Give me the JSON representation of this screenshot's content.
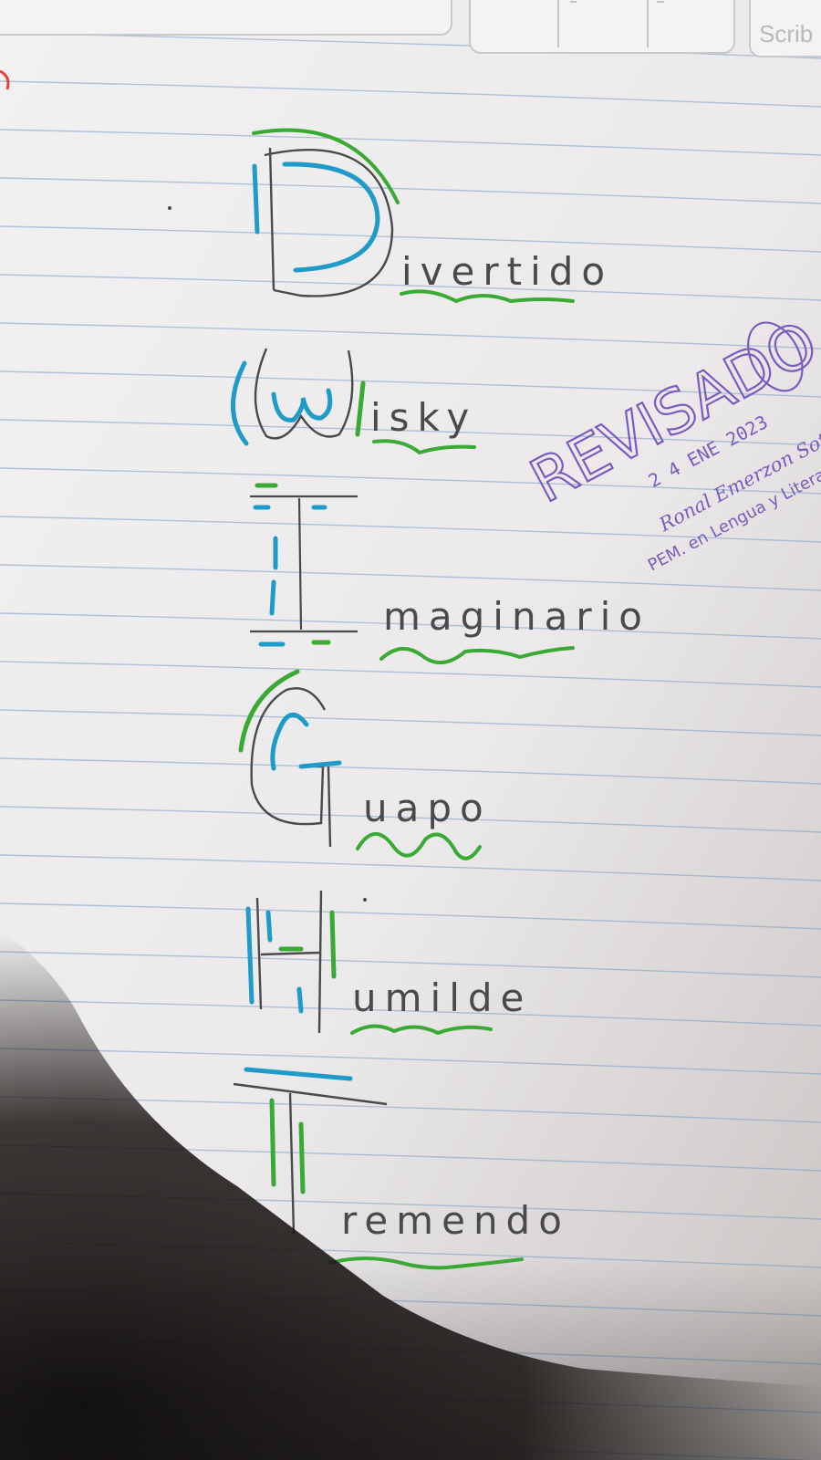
{
  "colors": {
    "paper": "#ecebec",
    "paper_dark": "#c9c5c4",
    "ruled_line": "#7c9bc4",
    "margin_line": "#e0453c",
    "pencil": "#4a4a4a",
    "blue_marker": "#1f9bc9",
    "green_marker": "#3aaa35",
    "stamp_ink": "#7a5cc0",
    "shadow": "#0f0c0b"
  },
  "top_strip": {
    "label_partial": "Scrib",
    "icon": "ruler-tick-marks-icon"
  },
  "acrostic": {
    "words": [
      {
        "letter": "D",
        "rest": "ivertido"
      },
      {
        "letter": "W",
        "rest": "isky"
      },
      {
        "letter": "I",
        "rest": "maginario"
      },
      {
        "letter": "G",
        "rest": "uapo"
      },
      {
        "letter": "H",
        "rest": "umilde"
      },
      {
        "letter": "T",
        "rest": "remendo"
      }
    ]
  },
  "stamp": {
    "title": "REVISADO",
    "date": "2 4 ENE 2023",
    "name": "Ronal Emerzon Soto",
    "credential": "PEM. en Lengua y Literatura"
  }
}
